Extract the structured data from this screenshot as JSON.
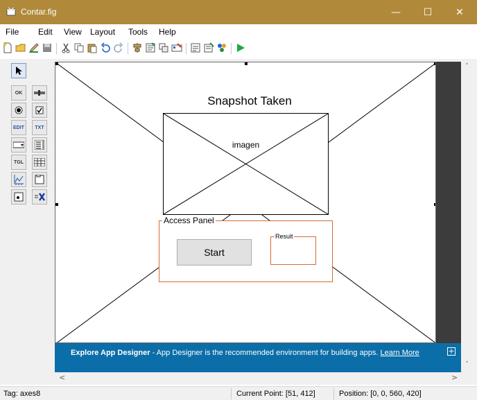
{
  "window": {
    "title": "Contar.fig",
    "minimize_glyph": "—",
    "maximize_glyph": "☐",
    "close_glyph": "✕"
  },
  "menu": {
    "items": [
      "File",
      "Edit",
      "View",
      "Layout",
      "Tools",
      "Help"
    ]
  },
  "toolbar": {
    "icons": [
      "new-icon",
      "open-icon",
      "edit-icon",
      "save-icon",
      "cut-icon",
      "copy-icon",
      "paste-icon",
      "undo-icon",
      "redo-icon",
      "align-icon",
      "menu-editor-icon",
      "tab-order-icon",
      "toolbar-editor-icon",
      "editor-icon",
      "property-inspector-icon",
      "object-browser-icon",
      "run-icon"
    ]
  },
  "palette": {
    "icons": [
      "select-arrow-icon",
      "push-button-icon",
      "slider-icon",
      "radio-button-icon",
      "checkbox-icon",
      "edit-text-icon",
      "static-text-icon",
      "popup-menu-icon",
      "listbox-icon",
      "toggle-button-icon",
      "table-icon",
      "axes-icon",
      "panel-icon",
      "button-group-icon",
      "activex-icon"
    ],
    "labels": {
      "push": "OK",
      "edit": "EDIT",
      "static": "TXT",
      "toggle": "TGL"
    }
  },
  "canvas": {
    "snapshot_title": "Snapshot Taken",
    "image_label": "imagen",
    "panel_title": "Access Panel",
    "start_button": "Start",
    "result_title": "Result"
  },
  "banner": {
    "bold": "Explore App Designer",
    "text": " - App Designer is the recommended environment for building apps. ",
    "link": "Learn More",
    "expand_glyph": "+"
  },
  "scrollbars": {
    "up": "˄",
    "down": "˅",
    "left": "<",
    "right": ">"
  },
  "status": {
    "tag": "Tag: axes8",
    "current_point": "Current Point:  [51, 412]",
    "position": "Position: [0, 0, 560, 420]"
  },
  "colors": {
    "titlebar": "#b08a3a",
    "banner": "#0b6ea8",
    "panel_border": "#d86a2e",
    "run": "#1fa84a"
  }
}
